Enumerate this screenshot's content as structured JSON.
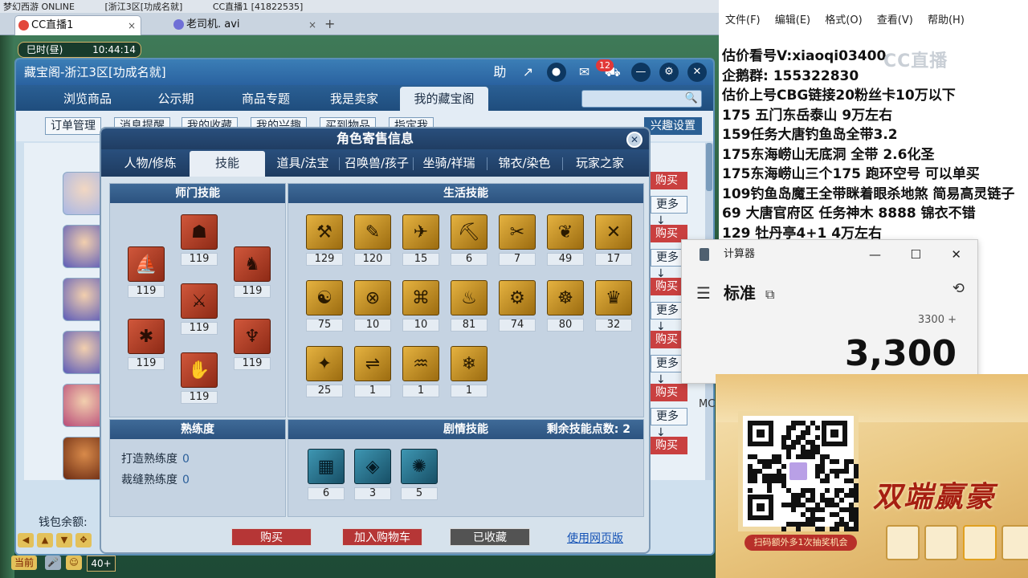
{
  "top_strip": {
    "left_text": "梦幻西游 ONLINE",
    "mid_text": "[浙江3区[功成名就]",
    "right_text": "CC直播1 [41822535]"
  },
  "tabs": [
    {
      "label": "CC直播1"
    },
    {
      "label": "老司机. avi"
    }
  ],
  "game": {
    "time_label": "巳时(昼)",
    "clock": "10:44:14"
  },
  "main_window": {
    "title": "藏宝阁-浙江3区[功成名就]",
    "help_label": "助",
    "cart_badge": "12",
    "nav_tabs": [
      "浏览商品",
      "公示期",
      "商品专题",
      "我是卖家",
      "我的藏宝阁"
    ],
    "sub_buttons": [
      "订单管理",
      "消息提醒",
      "我的收藏",
      "我的兴趣",
      "买到物品",
      "指定我"
    ],
    "interest_button": "兴趣设置",
    "buy_label": "购买",
    "more_label": "更多↓",
    "wallet_label": "钱包余额:"
  },
  "modal": {
    "title": "角色寄售信息",
    "tabs": [
      "人物/修炼",
      "技能",
      "道具/法宝",
      "召唤兽/孩子",
      "坐骑/祥瑞",
      "锦衣/染色",
      "玩家之家"
    ],
    "active_tab": "技能",
    "school_skills": {
      "header": "师门技能",
      "items": [
        {
          "icon": "ship-icon",
          "level": "119"
        },
        {
          "icon": "mask-icon",
          "level": "119"
        },
        {
          "icon": "beast-icon",
          "level": "119"
        },
        {
          "icon": "blade-icon",
          "level": "119"
        },
        {
          "icon": "bug-icon",
          "level": "119"
        },
        {
          "icon": "demon-icon",
          "level": "119"
        },
        {
          "icon": "claw-icon",
          "level": "119"
        }
      ]
    },
    "life_skills": {
      "header": "生活技能",
      "levels": [
        "129",
        "120",
        "15",
        "6",
        "7",
        "49",
        "17",
        "75",
        "10",
        "10",
        "81",
        "74",
        "80",
        "32",
        "25",
        "1",
        "1",
        "1"
      ]
    },
    "proficiency": {
      "header": "熟练度",
      "rows": [
        {
          "label": "打造熟练度",
          "value": "0"
        },
        {
          "label": "裁缝熟练度",
          "value": "0"
        }
      ]
    },
    "story_skills": {
      "header": "剧情技能",
      "remaining_label": "剩余技能点数:",
      "remaining_value": "2",
      "levels": [
        "6",
        "3",
        "5"
      ]
    },
    "buttons": {
      "buy": "购买",
      "add_cart": "加入购物车",
      "favorited": "已收藏",
      "web": "使用网页版"
    }
  },
  "hud": {
    "current_label": "当前",
    "level": "40+"
  },
  "notepad": {
    "menu": [
      "文件(F)",
      "编辑(E)",
      "格式(O)",
      "查看(V)",
      "帮助(H)"
    ],
    "lines": [
      "估价看号V:xiaoqi03400",
      "企鹅群: 155322830",
      "估价上号CBG链接20粉丝卡10万以下",
      "175 五门东岳泰山  9万左右",
      "159任务大唐钓鱼岛全带3.2",
      "175东海崂山无底洞  全带   2.6化圣",
      "175东海崂山三个175 跑环空号 可以单买",
      "109钓鱼岛魔王全带眯着眼杀地煞 简易高灵链子",
      "69  大唐官府区 任务神木 8888 锦衣不错",
      "129 牡丹亭4+1 4万左右"
    ],
    "watermark": "CC直播"
  },
  "calculator": {
    "title": "计算器",
    "mode": "标准",
    "expression": "3300 +",
    "result": "3,300",
    "memory_label": "MC"
  },
  "promo": {
    "caption": "扫码额外多1次抽奖机会",
    "slogan": "双端赢豪"
  },
  "colors": {
    "window_blue": "#2a62a0",
    "buy_red": "#b63636",
    "skill_gold": "#e5b240",
    "skill_red": "#d0573b",
    "skill_teal": "#3e96b2"
  }
}
